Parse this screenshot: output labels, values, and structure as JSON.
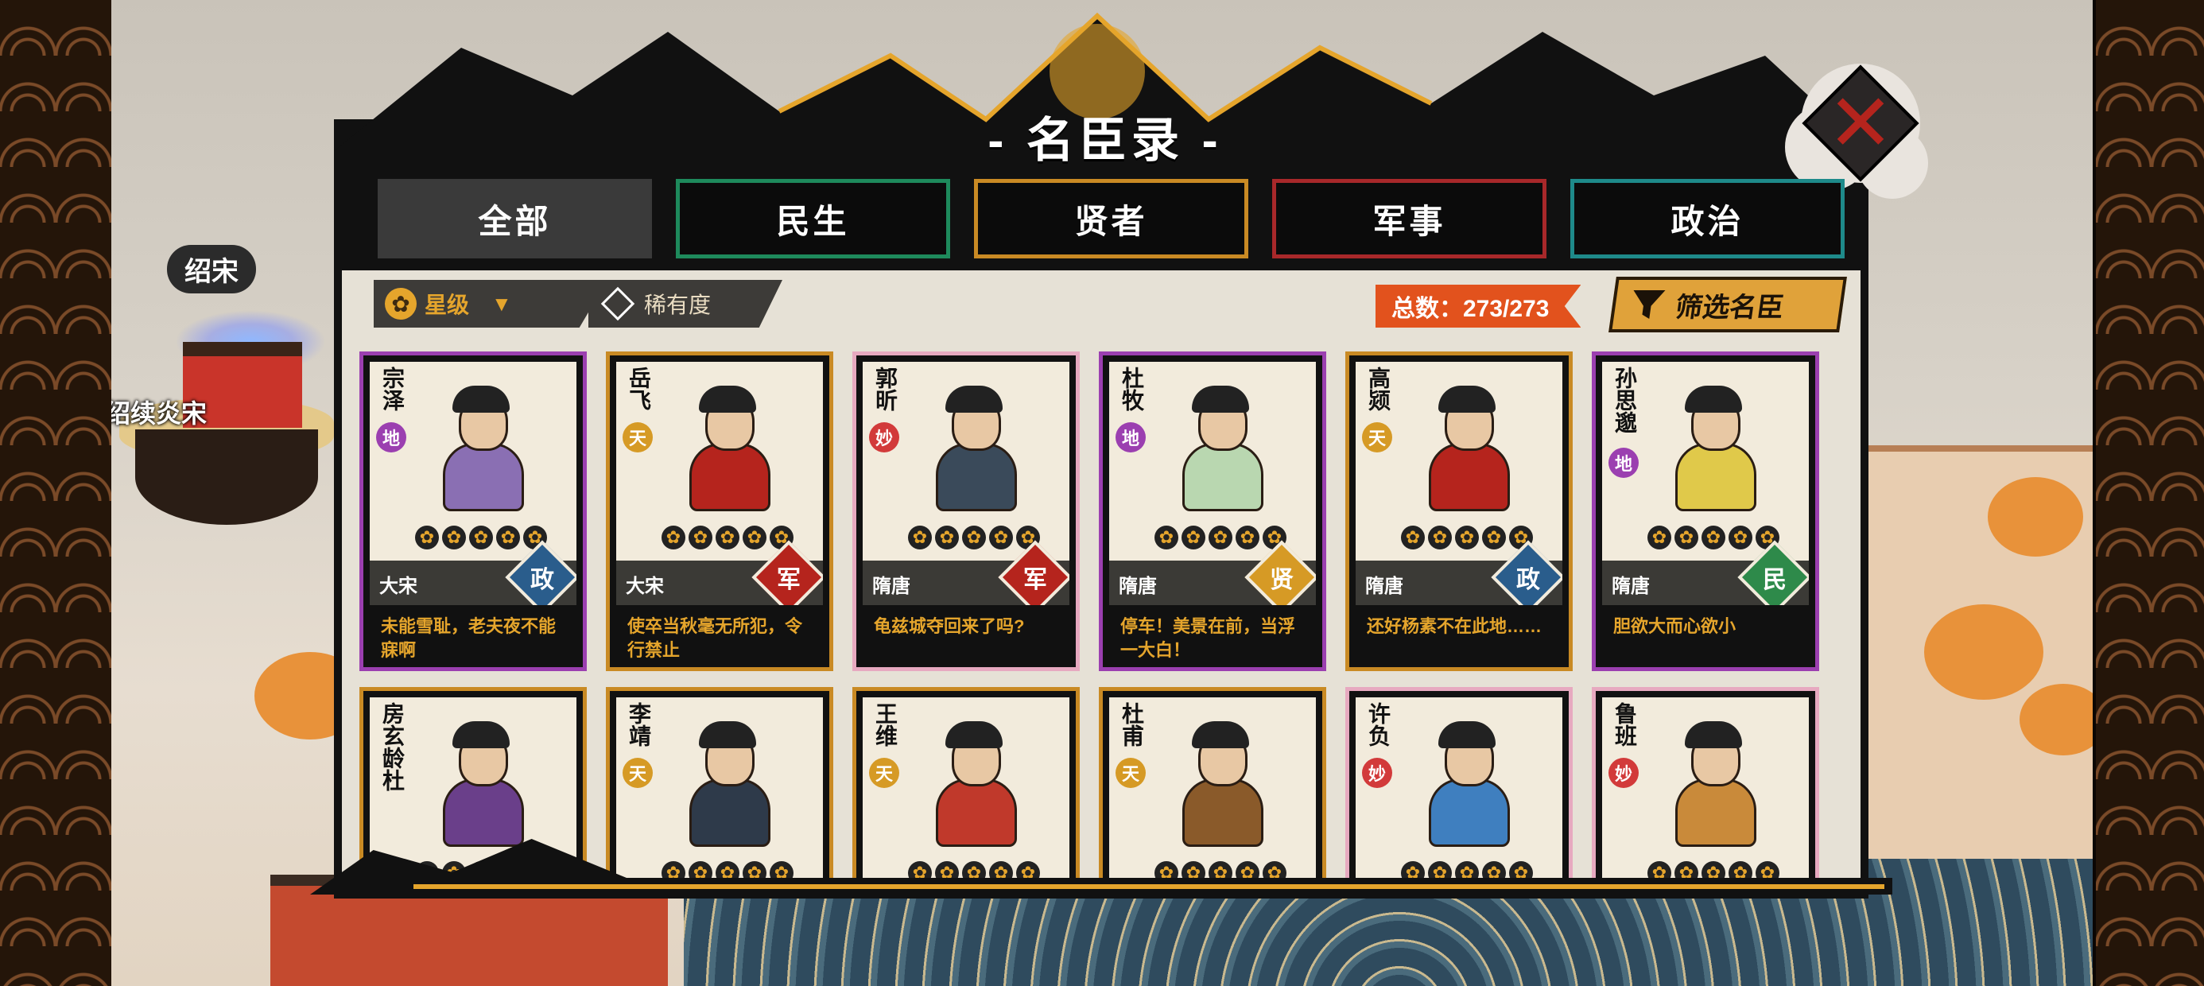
{
  "dialog": {
    "title": "- 名臣录 -"
  },
  "tabs": [
    {
      "label": "全部",
      "border": "#3a3a3a",
      "active": true
    },
    {
      "label": "民生",
      "border": "#1e8a5c",
      "active": false
    },
    {
      "label": "贤者",
      "border": "#c98a24",
      "active": false
    },
    {
      "label": "军事",
      "border": "#a8282a",
      "active": false
    },
    {
      "label": "政治",
      "border": "#1e8a8a",
      "active": false
    }
  ],
  "filters": {
    "sort_icon": "flower-icon",
    "sort_label": "星级",
    "rarity_icon": "diamond-icon",
    "rarity_label": "稀有度",
    "total": "总数：273/273",
    "screen_button": "筛选名臣"
  },
  "map": {
    "tag": "绍宋",
    "place": "绍续炎宋"
  },
  "rarity_colors": {
    "地": "#9b3fb0",
    "天": "#d69a25",
    "妙": "#d23a3a"
  },
  "role_colors": {
    "政": "#2a5d8c",
    "军": "#b5241d",
    "贤": "#d69a25",
    "民": "#2e8a4a"
  },
  "cards": [
    {
      "name": "宗泽",
      "rarity": "地",
      "dynasty": "大宋",
      "role": "政",
      "quote": "未能雪耻，老夫夜不能寐啊",
      "frame": "#9b3fb0",
      "robe": "#8a6fb3",
      "stars": 5
    },
    {
      "name": "岳飞",
      "rarity": "天",
      "dynasty": "大宋",
      "role": "军",
      "quote": "使卒当秋毫无所犯，令行禁止",
      "frame": "#c98a24",
      "robe": "#b5241d",
      "stars": 5
    },
    {
      "name": "郭昕",
      "rarity": "妙",
      "dynasty": "隋唐",
      "role": "军",
      "quote": "龟兹城夺回来了吗?",
      "frame": "#e7a9c0",
      "robe": "#3a4a5a",
      "stars": 5
    },
    {
      "name": "杜牧",
      "rarity": "地",
      "dynasty": "隋唐",
      "role": "贤",
      "quote": "停车！美景在前，当浮一大白！",
      "frame": "#9b3fb0",
      "robe": "#b9d7b0",
      "stars": 5
    },
    {
      "name": "高颎",
      "rarity": "天",
      "dynasty": "隋唐",
      "role": "政",
      "quote": "还好杨素不在此地……",
      "frame": "#c98a24",
      "robe": "#b5241d",
      "stars": 5
    },
    {
      "name": "孙思邈",
      "rarity": "地",
      "dynasty": "隋唐",
      "role": "民",
      "quote": "胆欲大而心欲小",
      "frame": "#9b3fb0",
      "robe": "#e0c94a",
      "stars": 5
    },
    {
      "name": "房玄龄杜",
      "rarity": "",
      "dynasty": "",
      "role": "",
      "quote": "",
      "frame": "#c98a24",
      "robe": "#6a3f8a",
      "stars": 5
    },
    {
      "name": "李靖",
      "rarity": "天",
      "dynasty": "",
      "role": "",
      "quote": "",
      "frame": "#c98a24",
      "robe": "#2e3a4a",
      "stars": 5
    },
    {
      "name": "王维",
      "rarity": "天",
      "dynasty": "",
      "role": "",
      "quote": "",
      "frame": "#c98a24",
      "robe": "#c0392b",
      "stars": 5
    },
    {
      "name": "杜甫",
      "rarity": "天",
      "dynasty": "",
      "role": "",
      "quote": "",
      "frame": "#c98a24",
      "robe": "#8a5a2a",
      "stars": 5
    },
    {
      "name": "许负",
      "rarity": "妙",
      "dynasty": "",
      "role": "",
      "quote": "",
      "frame": "#e7a9c0",
      "robe": "#3f7fbf",
      "stars": 5
    },
    {
      "name": "鲁班",
      "rarity": "妙",
      "dynasty": "",
      "role": "",
      "quote": "",
      "frame": "#e7a9c0",
      "robe": "#c98a3a",
      "stars": 5
    }
  ]
}
